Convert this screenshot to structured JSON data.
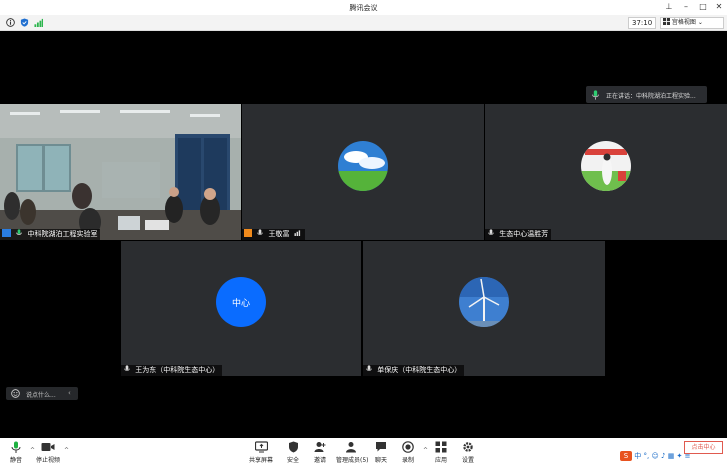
{
  "window": {
    "title": "腾讯会议",
    "controls": {
      "pin": "⊥",
      "minimize": "–",
      "maximize": "□",
      "close": "✕"
    }
  },
  "infobar": {
    "timer": "37:10",
    "view_mode": "宫格视图",
    "icons": [
      "info-icon",
      "shield-icon",
      "signal-icon"
    ]
  },
  "speaking": {
    "label": "正在讲话：中科院湖泊工程实验..."
  },
  "tiles": [
    {
      "name": "中科院湖泊工程实验室",
      "kind": "video"
    },
    {
      "name": "王敬富",
      "kind": "avatar-sky"
    },
    {
      "name": "生态中心温胜芳",
      "kind": "avatar-photo"
    },
    {
      "name": "王为东（中科院生态中心）",
      "kind": "avatar-text",
      "avatar_text": "中心"
    },
    {
      "name": "单保庆（中科院生态中心）",
      "kind": "avatar-windmill"
    }
  ],
  "chat": {
    "placeholder": "说点什么..."
  },
  "toolbar": {
    "mute": "静音",
    "stop_video": "停止视频",
    "share_screen": "共享屏幕",
    "security": "安全",
    "invite": "邀请",
    "manage_members": "管理成员(5)",
    "chat": "聊天",
    "record": "录制",
    "apps": "应用",
    "settings": "设置"
  },
  "tray": {
    "ime": "中",
    "red_box": "点击中心"
  },
  "colors": {
    "accent": "#0a6cff",
    "mic_green": "#1fb141",
    "tile_bg": "#2b2d30"
  }
}
